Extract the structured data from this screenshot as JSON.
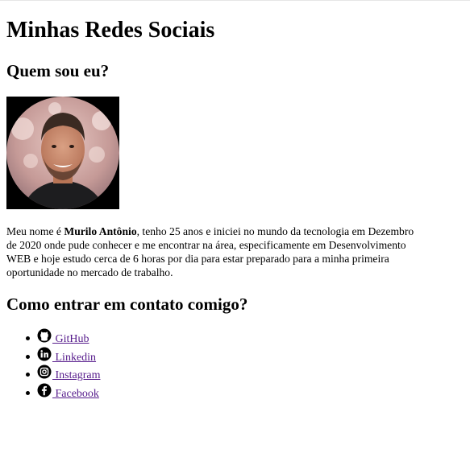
{
  "page": {
    "title": "Minhas Redes Sociais",
    "about_heading": "Quem sou eu?",
    "photo_icon": "profile-photo",
    "bio": {
      "before": "Meu nome é ",
      "name": "Murilo Antônio",
      "after": ", tenho 25 anos e iniciei no mundo da tecnologia em Dezembro de 2020 onde pude conhecer e me encontrar na área, especificamente em Desenvolvimento WEB e hoje estudo cerca de 6 horas por dia para estar preparado para a minha primeira oportunidade no mercado de trabalho."
    },
    "contact_heading": "Como entrar em contato comigo?"
  },
  "links": [
    {
      "label": " GitHub",
      "icon": "github-icon"
    },
    {
      "label": " Linkedin",
      "icon": "linkedin-icon"
    },
    {
      "label": " Instagram",
      "icon": "instagram-icon"
    },
    {
      "label": " Facebook",
      "icon": "facebook-icon"
    }
  ],
  "colors": {
    "link": "#551a8b",
    "text": "#000000",
    "background": "#ffffff"
  }
}
